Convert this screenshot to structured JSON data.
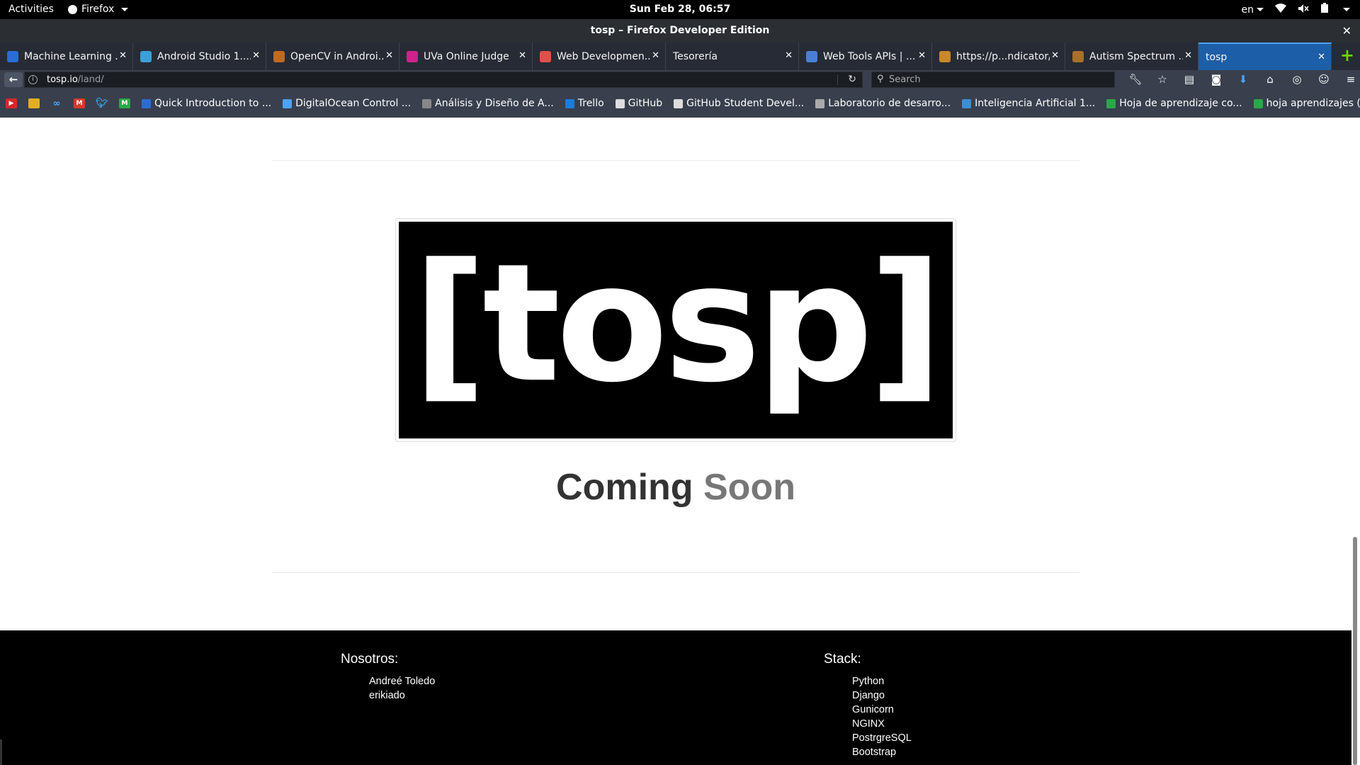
{
  "system_bar": {
    "activities": "Activities",
    "app_menu": "Firefox",
    "clock": "Sun Feb 28, 06:57",
    "language": "en"
  },
  "window": {
    "title": "tosp – Firefox Developer Edition"
  },
  "tabs": [
    {
      "label": "Machine Learning ...",
      "favicon_color": "#2b6cd6"
    },
    {
      "label": "Android Studio 1....",
      "favicon_color": "#3aa0d8"
    },
    {
      "label": "OpenCV in Androi...",
      "favicon_color": "#c06a20"
    },
    {
      "label": "UVa Online Judge",
      "favicon_color": "#d0228a"
    },
    {
      "label": "Web Developmen...",
      "favicon_color": "#e0504a"
    },
    {
      "label": "Tesorería",
      "favicon_color": ""
    },
    {
      "label": "Web Tools APIs | ...",
      "favicon_color": "#4a7fd4"
    },
    {
      "label": "https://p...ndicator/",
      "favicon_color": "#c9882a"
    },
    {
      "label": "Autism Spectrum ...",
      "favicon_color": "#a8702a"
    },
    {
      "label": "tosp",
      "favicon_color": "",
      "active": true
    }
  ],
  "navbar": {
    "url_host": "tosp.io",
    "url_path": "/land/",
    "search_placeholder": "Search"
  },
  "bookmarks": [
    {
      "label": "Quick Introduction to ...",
      "favicon_color": "#2b6cd6"
    },
    {
      "label": "DigitalOcean Control ...",
      "favicon_color": "#4aa3ff"
    },
    {
      "label": "Análisis y Diseño de A...",
      "favicon_color": "#888888"
    },
    {
      "label": "Trello",
      "favicon_color": "#1e7bd6"
    },
    {
      "label": "GitHub",
      "favicon_color": "#dddddd"
    },
    {
      "label": "GitHub Student Devel...",
      "favicon_color": "#dddddd"
    },
    {
      "label": "Laboratorio de desarro...",
      "favicon_color": "#aaaaaa"
    },
    {
      "label": "Inteligencia Artificial 1...",
      "favicon_color": "#3a8fd6"
    },
    {
      "label": "Hoja de aprendizaje co...",
      "favicon_color": "#2aa84a"
    },
    {
      "label": "hoja aprendizajes (indi...",
      "favicon_color": "#2aa84a"
    }
  ],
  "page": {
    "logo_text": "[tosp]",
    "heading_main": "Coming",
    "heading_accent": "Soon"
  },
  "footer": {
    "about_title": "Nosotros:",
    "about_items": [
      "Andreé Toledo",
      "erikiado"
    ],
    "stack_title": "Stack:",
    "stack_items": [
      "Python",
      "Django",
      "Gunicorn",
      "NGINX",
      "PostrgreSQL",
      "Bootstrap"
    ]
  }
}
